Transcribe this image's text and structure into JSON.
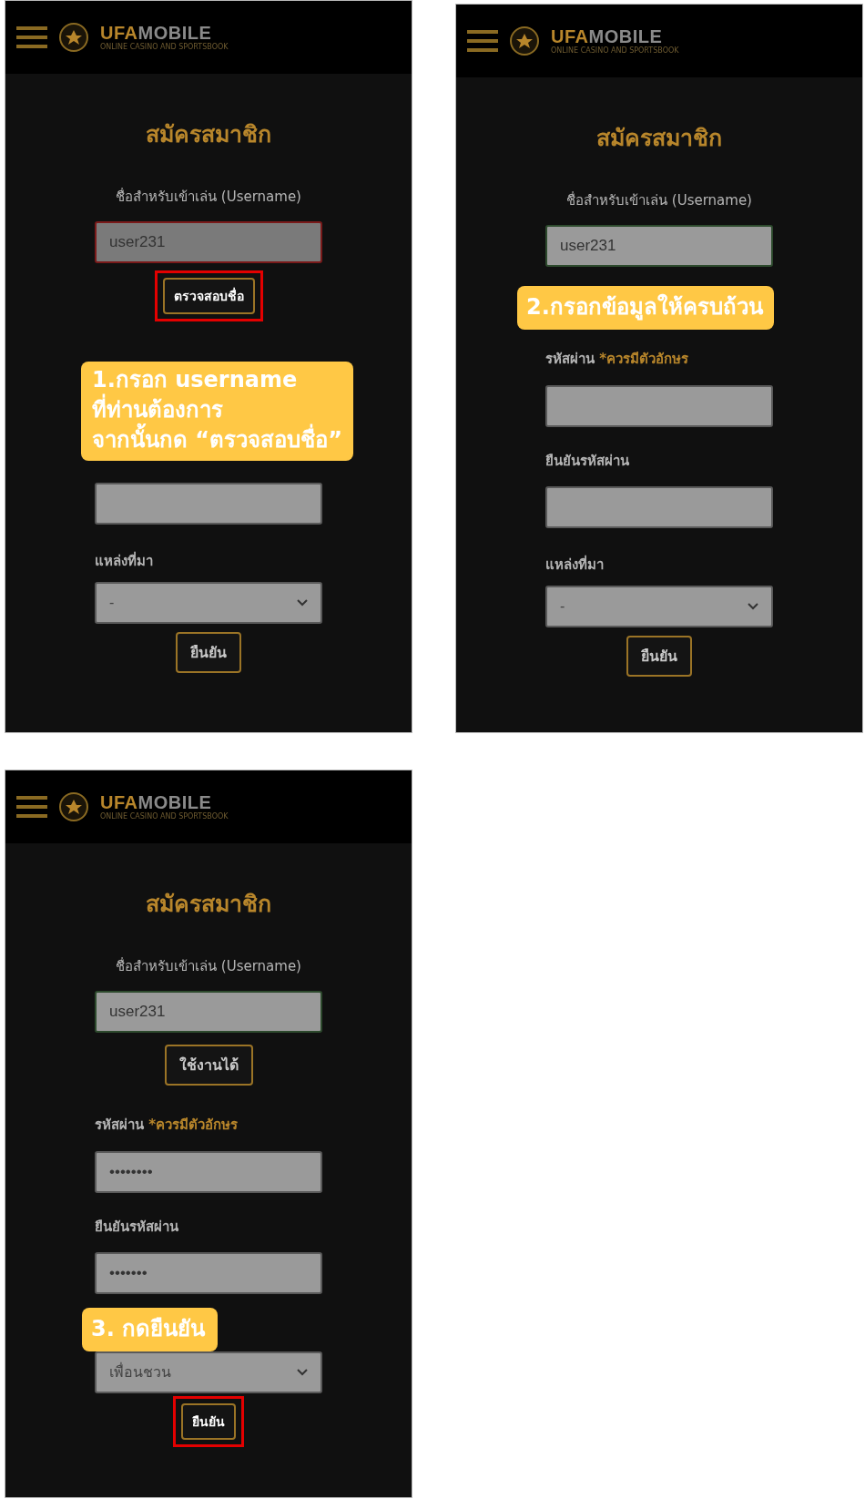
{
  "panels": [
    {
      "header": {
        "logo_accent": "UFA",
        "logo_rest": "MOBILE",
        "logo_tagline": "ONLINE CASINO AND SPORTSBOOK"
      },
      "title": "สมัครสมาชิก",
      "username_label": "ชื่อสำหรับเข้าเล่น (Username)",
      "username_field": {
        "value": "user231",
        "error": true
      },
      "check_button": {
        "label": "ตรวจสอบชื่อ",
        "highlighted": true
      },
      "confirm_field": {
        "kind": "empty"
      },
      "source_label": "แหล่งที่มา",
      "source_select": {
        "value": "-"
      },
      "submit_button": {
        "label": "ยืนยัน",
        "highlighted": false
      },
      "callout": {
        "kind": "three_line",
        "lines": [
          "1.กรอก username",
          "ที่ท่านต้องการ",
          "จากนั้นกด “ตรวจสอบชื่อ”"
        ]
      }
    },
    {
      "header": {
        "logo_accent": "UFA",
        "logo_rest": "MOBILE",
        "logo_tagline": "ONLINE CASINO AND SPORTSBOOK"
      },
      "title": "สมัครสมาชิก",
      "username_label": "ชื่อสำหรับเข้าเล่น (Username)",
      "username_field": {
        "value": "user231",
        "error": false
      },
      "password_label": {
        "text": "รหัสผ่าน",
        "note": "*ควรมีตัวอักษร"
      },
      "password_field": {
        "kind": "empty"
      },
      "confirm_label": "ยืนยันรหัสผ่าน",
      "confirm_field": {
        "kind": "empty"
      },
      "source_label": "แหล่งที่มา",
      "source_select": {
        "value": "-"
      },
      "submit_button": {
        "label": "ยืนยัน",
        "highlighted": false
      },
      "callout": {
        "kind": "below_username",
        "lines": [
          "2.กรอกข้อมูลให้ครบถ้วน"
        ]
      }
    },
    {
      "header": {
        "logo_accent": "UFA",
        "logo_rest": "MOBILE",
        "logo_tagline": "ONLINE CASINO AND SPORTSBOOK"
      },
      "title": "สมัครสมาชิก",
      "username_label": "ชื่อสำหรับเข้าเล่น (Username)",
      "username_field": {
        "value": "user231",
        "error": false
      },
      "check_button": {
        "label": "ใช้งานได้",
        "highlighted": false
      },
      "password_label": {
        "text": "รหัสผ่าน",
        "note": "*ควรมีตัวอักษร"
      },
      "password_field": {
        "kind": "filled",
        "value": "••••••••"
      },
      "confirm_label": "ยืนยันรหัสผ่าน",
      "confirm_field": {
        "kind": "filled",
        "value": "•••••••"
      },
      "source_select": {
        "value": "เพื่อนชวน"
      },
      "submit_button": {
        "label": "ยืนยัน",
        "highlighted": true
      },
      "callout": {
        "kind": "above_select",
        "lines": [
          "3. กดยืนยัน"
        ]
      }
    }
  ]
}
